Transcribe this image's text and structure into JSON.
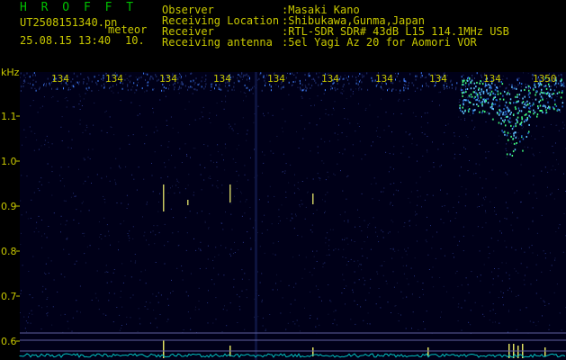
{
  "header": {
    "title": "H R O F F T",
    "filename": "UT2508151340.pn",
    "mode": "meteor",
    "datetime": "25.08.15 13:40",
    "interval": "10.",
    "observer_label": "Observer",
    "observer_value": ":Masaki Kano",
    "location_label": "Receiving Location",
    "location_value": ":Shibukawa,Gunma,Japan",
    "receiver_label": "Receiver",
    "receiver_value": ":RTL-SDR SDR# 43dB L15 114.1MHz USB",
    "antenna_label": "Receiving antenna",
    "antenna_value": ":5el Yagi Az 20 for Aomori VOR"
  },
  "axis": {
    "unit": "kHz",
    "y_ticks": [
      "1.1",
      "1.0",
      "0.9",
      "0.8",
      "0.7",
      "0.6"
    ],
    "time_ticks": [
      "134",
      "134",
      "134",
      "134",
      "134",
      "134",
      "134",
      "134",
      "134",
      "1350"
    ]
  },
  "colors": {
    "background": "#000010",
    "text": "#c8c800",
    "title": "#00c000",
    "signal": "#40a0ff",
    "baseline": "#00c0c0"
  }
}
